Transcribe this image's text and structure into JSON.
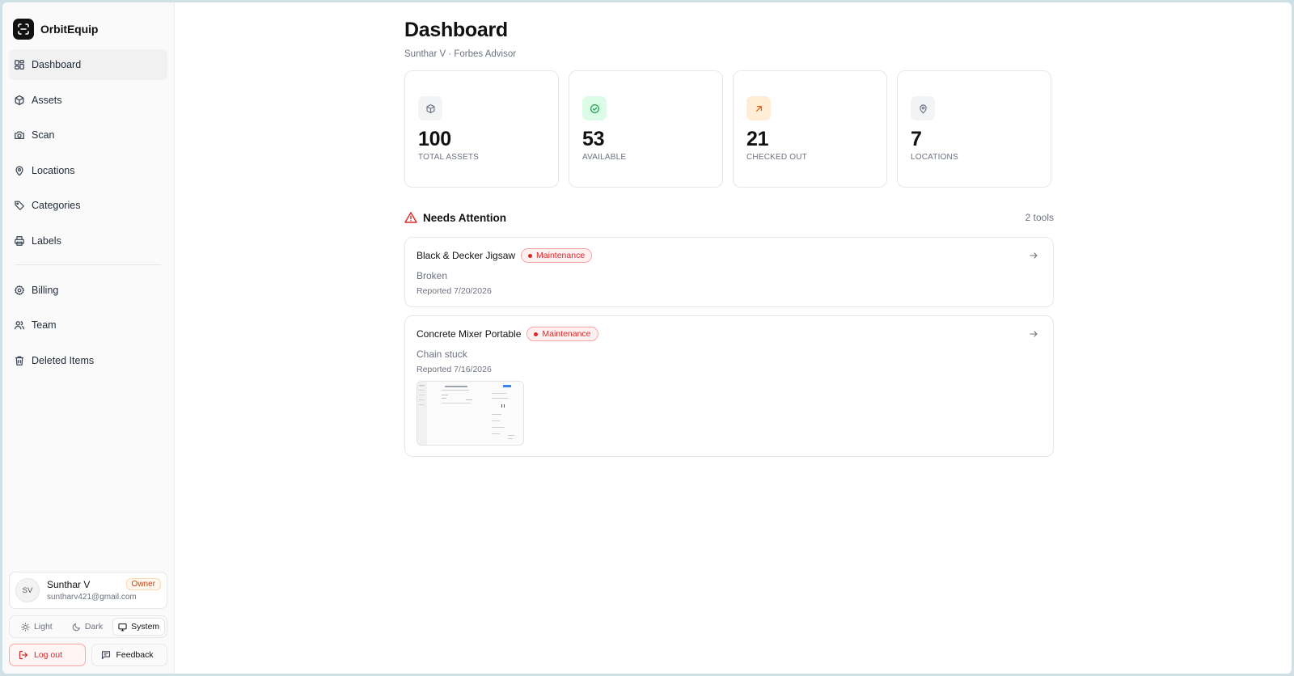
{
  "app": {
    "name": "OrbitEquip"
  },
  "sidebar": {
    "items": [
      {
        "label": "Dashboard",
        "icon": "dashboard-icon",
        "active": true
      },
      {
        "label": "Assets",
        "icon": "box-icon"
      },
      {
        "label": "Scan",
        "icon": "camera-icon"
      },
      {
        "label": "Locations",
        "icon": "map-pin-icon"
      },
      {
        "label": "Categories",
        "icon": "tag-icon"
      },
      {
        "label": "Labels",
        "icon": "printer-icon"
      },
      {
        "label": "Billing",
        "icon": "gear-icon"
      },
      {
        "label": "Team",
        "icon": "users-icon"
      },
      {
        "label": "Deleted Items",
        "icon": "trash-icon"
      }
    ],
    "user": {
      "initials": "SV",
      "name": "Sunthar V",
      "email": "suntharv421@gmail.com",
      "role": "Owner"
    },
    "theme": {
      "light": "Light",
      "dark": "Dark",
      "system": "System",
      "selected": "System"
    },
    "logout_label": "Log out",
    "feedback_label": "Feedback"
  },
  "main": {
    "title": "Dashboard",
    "subtitle": "Sunthar V · Forbes Advisor",
    "stats": [
      {
        "value": "100",
        "label": "TOTAL ASSETS",
        "icon": "box-icon",
        "color": "#f3f4f6"
      },
      {
        "value": "53",
        "label": "AVAILABLE",
        "icon": "check-circle-icon",
        "color": "#dcfce7"
      },
      {
        "value": "21",
        "label": "CHECKED OUT",
        "icon": "arrow-up-right-icon",
        "color": "#ffedd5"
      },
      {
        "value": "7",
        "label": "LOCATIONS",
        "icon": "map-pin-icon",
        "color": "#f3f4f6"
      }
    ],
    "attention": {
      "title": "Needs Attention",
      "count": "2 tools",
      "items": [
        {
          "name": "Black & Decker Jigsaw",
          "status": "Maintenance",
          "note": "Broken",
          "date": "Reported 7/20/2026"
        },
        {
          "name": "Concrete Mixer Portable",
          "status": "Maintenance",
          "note": "Chain stuck",
          "date": "Reported 7/16/2026"
        }
      ]
    }
  },
  "colors": {
    "accent_red": "#dc2626",
    "available_green": "#16a34a",
    "checkout_orange": "#ea580c"
  }
}
